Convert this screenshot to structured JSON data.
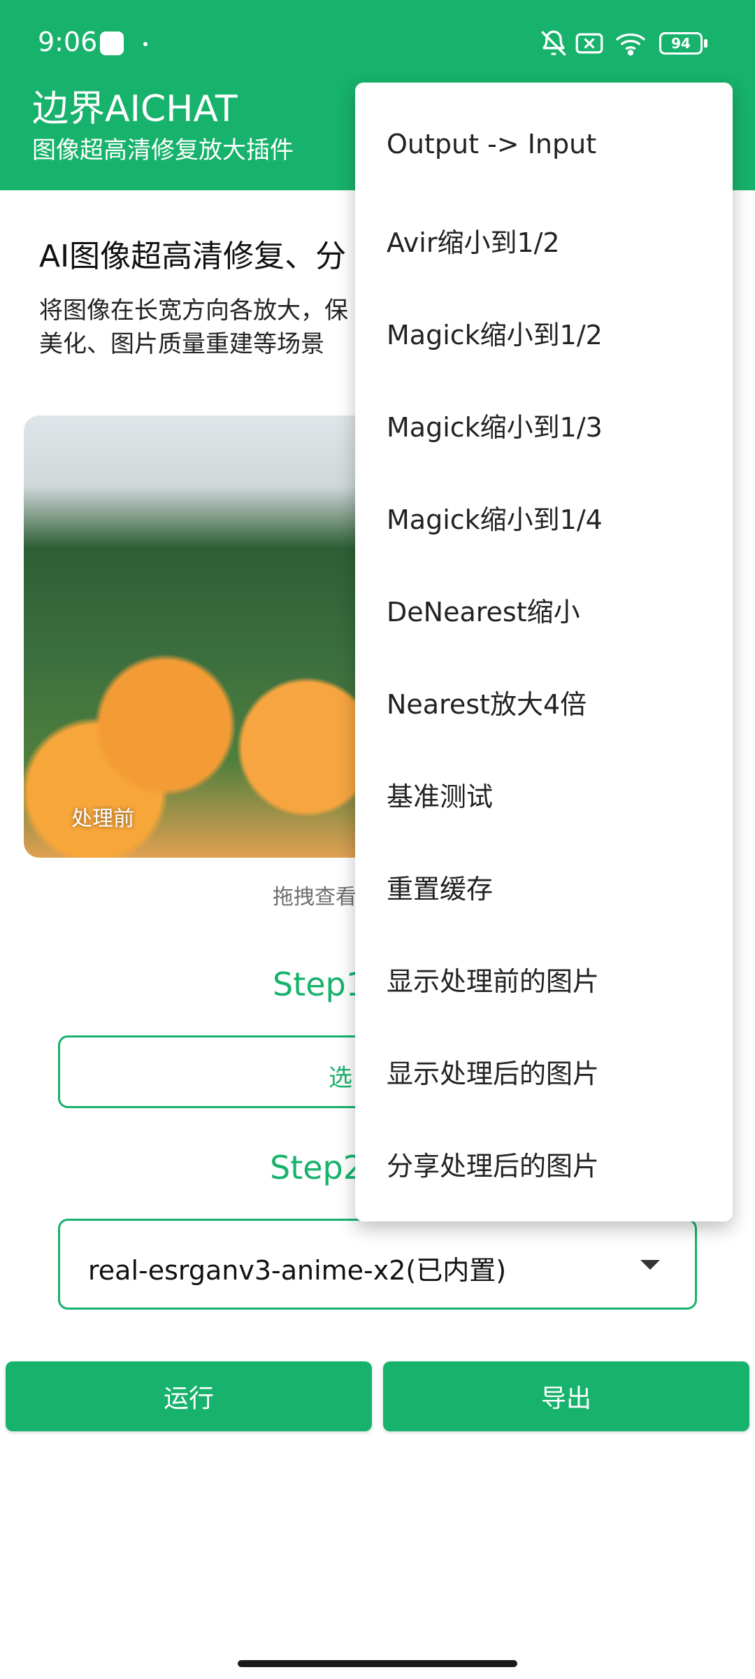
{
  "status": {
    "time": "9:06",
    "battery": "94"
  },
  "app": {
    "title": "边界AICHAT",
    "subtitle": "图像超高清修复放大插件"
  },
  "main": {
    "headline": "AI图像超高清修复、分",
    "description": "将图像在长宽方向各放大，保\n美化、图片质量重建等场景",
    "photo_label": "处理前",
    "drag_hint": "拖拽查看",
    "step1_label": "Step1",
    "select_button_text": "选",
    "step2_label": "Step2",
    "model_select_value": "real-esrganv3-anime-x2(已内置)"
  },
  "actions": {
    "run": "运行",
    "export": "导出"
  },
  "menu": {
    "items": [
      "Output -> Input",
      "Avir缩小到1/2",
      "Magick缩小到1/2",
      "Magick缩小到1/3",
      "Magick缩小到1/4",
      "DeNearest缩小",
      "Nearest放大4倍",
      "基准测试",
      "重置缓存",
      "显示处理前的图片",
      "显示处理后的图片",
      "分享处理后的图片"
    ]
  },
  "icons": {
    "status_right": [
      "bell-off-icon",
      "box-x-icon",
      "wifi-icon",
      "battery-icon"
    ],
    "dropdown_caret": "caret-down-icon"
  }
}
